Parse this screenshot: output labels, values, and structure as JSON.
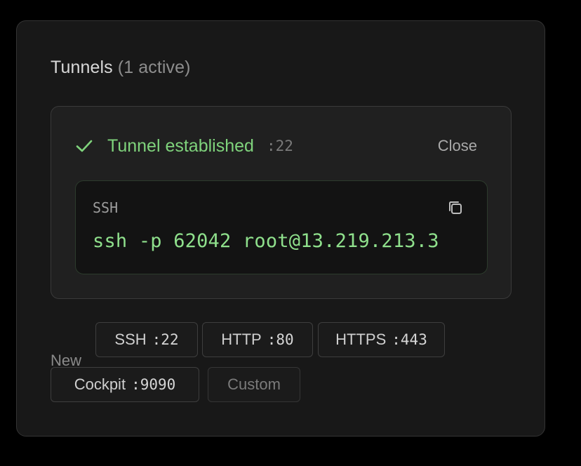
{
  "panel": {
    "title": "Tunnels",
    "active_count": "(1 active)"
  },
  "tunnel": {
    "status": "Tunnel established",
    "port": ":22",
    "close_label": "Close",
    "protocol_label": "SSH",
    "command": "ssh -p 62042 root@13.219.213.3",
    "status_color": "#7fd37c"
  },
  "new_tunnel": {
    "label": "New",
    "options": [
      {
        "name": "SSH",
        "port": ":22"
      },
      {
        "name": "HTTP",
        "port": ":80"
      },
      {
        "name": "HTTPS",
        "port": ":443"
      },
      {
        "name": "Cockpit",
        "port": ":9090"
      }
    ],
    "custom_label": "Custom"
  },
  "icons": {
    "status": "check-icon",
    "copy": "copy-icon"
  }
}
